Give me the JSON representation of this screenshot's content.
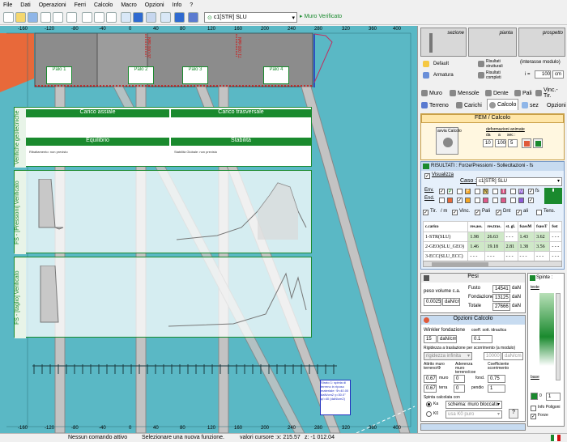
{
  "menu": [
    "File",
    "Dati",
    "Operazioni",
    "Ferri",
    "Calcolo",
    "Macro",
    "Opzioni",
    "Info",
    "?"
  ],
  "toolbar": {
    "combination": "c1[STR] SLU",
    "view": "Muro Verificato"
  },
  "canvas": {
    "ruler_top": [
      "-160",
      "-120",
      "-80",
      "-40",
      "0",
      "40",
      "80",
      "120",
      "160",
      "200",
      "240",
      "280",
      "320",
      "360",
      "400"
    ],
    "ruler_bottom": [
      "-160",
      "-120",
      "-80",
      "-40",
      "0",
      "40",
      "80",
      "120",
      "160",
      "200",
      "240",
      "280",
      "320",
      "360",
      "400"
    ],
    "piles": [
      "Palo 1",
      "Palo 2",
      "Palo 3",
      "Palo 4"
    ],
    "dim_labels": [
      "20 000 daN",
      "71 000 daN"
    ],
    "geo_title": "Verifiche geotecniche",
    "carico_assiale": "Carico assiale",
    "carico_trasversale": "Carico trasversale",
    "equilibrio": "Equilibrio",
    "stabilita": "Stabilità",
    "equilibrio_note": "Ribaltamento: non previsto",
    "stabilita_note": "Stabilità Globale: non previsto",
    "fs_pressioni": "FS - [Pressioni] Verificato",
    "fs_taglio": "FS - [taglio] Verificato",
    "annotation": "Strato 1: spinta di terreno in riposo materiale: Φ=40.00 daN/cm2 γ=30.0° φ'=40 (daN/cm2)"
  },
  "status": {
    "command": "Nessun comando attivo",
    "hint": "Selezionare una nuova funzione.",
    "cursor_label": "valori cursore :",
    "x": "x: 215.57",
    "z": "z: -1 012.04"
  },
  "right": {
    "views": [
      "sezione",
      "pianta",
      "prospetto"
    ],
    "opt1": "Default",
    "opt2": "Armatura",
    "res1": "Risultati strutturali",
    "res2": "Risultati completi",
    "interasse_label": "(interasse modulo)",
    "interasse_val": "100",
    "interasse_unit": "cm",
    "l_label": "i =",
    "tabs1": [
      "Muro",
      "Mensole",
      "Dente",
      "Pali",
      "Vinc.-Tir."
    ],
    "tabs2": [
      "Terreno",
      "Carichi",
      "Calcolo",
      "sez",
      "Opzioni"
    ],
    "fem_title": "FEM / Calcolo",
    "avvia": "avvia Calcolo",
    "deformazioni": "deformazioni animate",
    "da_lbl": "da",
    "a_lbl": "a",
    "sec_lbl": "sec :",
    "da": "10",
    "a": "100",
    "sec": "5",
    "risultati_title": "RISULTATI : Forze/Pressioni - Sollecitazioni - fs",
    "visualizza": "Visualizza",
    "caso_lbl": "Caso :",
    "caso": "c1[STR] SLU",
    "env": "Env.",
    "end": "End.",
    "letters": [
      "P",
      "F",
      "N",
      "T",
      "M"
    ],
    "fs": "fs",
    "opts": [
      "Tir.",
      "/ m",
      "Vinc.",
      "Pali",
      "Dnt",
      "ali",
      "Tens."
    ],
    "table_headers": [
      "c.carico",
      "res.ass.",
      "res.tras.",
      "st. gl.",
      "fsassM",
      "fsassT",
      "fsst"
    ],
    "table_rows": [
      [
        "1-STR(SLU)",
        "1.98",
        "26.63",
        "- - -",
        "1.43",
        "3.62",
        "- - -"
      ],
      [
        "2-GEO(SLU_GEO)",
        "1.46",
        "19.18",
        "2.81",
        "1.38",
        "3.56",
        "- - -"
      ],
      [
        "3-ECC(SLU_ECC)",
        "- - -",
        "- - -",
        "- - -",
        "- - -",
        "- - -",
        "- - -"
      ]
    ],
    "pesi_title": "Pesi",
    "peso_volume": "peso volume c.a.",
    "peso_val": "0.0025",
    "peso_unit": "daN/cm3",
    "fusto_lbl": "Fusto",
    "fusto": "14541",
    "fond_lbl": "Fondazione",
    "fond": "13125",
    "tot_lbl": "Totale",
    "tot": "27666",
    "dan": "daN",
    "spinte_title": "Spinte :",
    "spinte_opt": "teste",
    "opzioni_title": "Opzioni Calcolo",
    "winkler": "Winkler fondazione",
    "winkler_val": "15",
    "winkler_unit": "daN/cm3",
    "coeff_sott": "coeff. sott. idraulica",
    "coeff_val": "0.1",
    "rigidezza": "Rigidezza a traslazione per scorrimento (a modulo)",
    "rigidezza_opt": "rigidezza infinita",
    "rigidezza_val": "10000",
    "rigidezza_unit": "daN/cm",
    "attrito": "Attrito muro terreno/Ф",
    "aderenza": "Aderenza muro terreno/coe",
    "coefficiente": "Coefficiente scorrimento",
    "muro_lbl": "muro",
    "terra_lbl": "terra",
    "fond2_lbl": "fond.",
    "pendio_lbl": "pendio",
    "attr_muro": "0.67",
    "attr_terra": "0.67",
    "ader_muro": "0",
    "ader_terra": "0",
    "coef_fond": "0.75",
    "coef_pend": "1",
    "spinta_calc": "Spinta calcolata con",
    "ka": "Ka",
    "k0": "K0",
    "schema": "schema: muro bloccato",
    "k0_opt": "usa K0 puro",
    "ques": "?",
    "info_poligono": "Info Poligoni",
    "forze": "Forze",
    "base": "base",
    "num": "0",
    "spinte_val": "1"
  },
  "colors": {
    "canvas": "#5ab8c5",
    "accent": "#1a8a2e",
    "orange": "#e8693a"
  }
}
